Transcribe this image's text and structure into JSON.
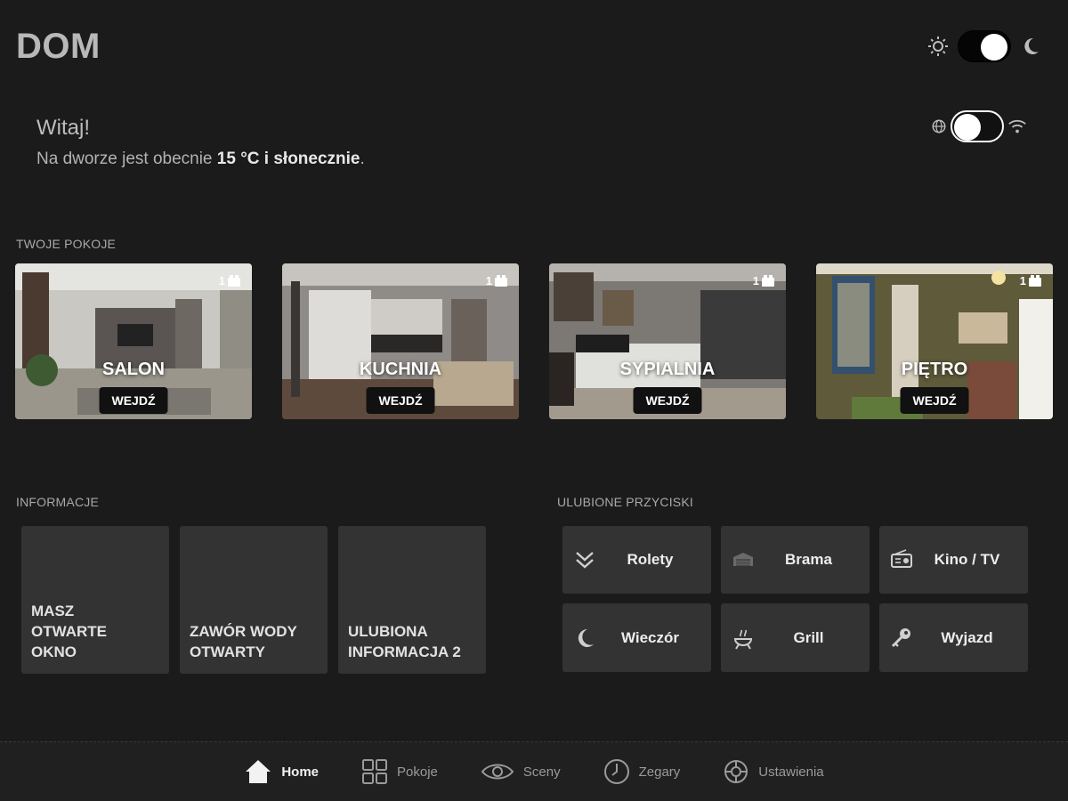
{
  "app": {
    "title": "DOM"
  },
  "greeting": {
    "hello": "Witaj!",
    "weather_prefix": "Na dworze jest obecnie",
    "weather_value": "15 °C i słonecznie",
    "weather_suffix": "."
  },
  "rooms_section": {
    "label": "TWOJE POKOJE",
    "rooms": [
      {
        "name": "SALON",
        "count": "1",
        "button": "WEJDŹ"
      },
      {
        "name": "KUCHNIA",
        "count": "1",
        "button": "WEJDŹ"
      },
      {
        "name": "SYPIALNIA",
        "count": "1",
        "button": "WEJDŹ"
      },
      {
        "name": "PIĘTRO",
        "count": "1",
        "button": "WEJDŹ"
      }
    ]
  },
  "info_section": {
    "label": "INFORMACJE",
    "tiles": [
      {
        "text": "MASZ\nOTWARTE\nOKNO"
      },
      {
        "text": "ZAWÓR WODY\nOTWARTY"
      },
      {
        "text": "ULUBIONA\nINFORMACJA 2"
      }
    ]
  },
  "favorites_section": {
    "label": "ULUBIONE PRZYCISKI",
    "buttons": [
      {
        "label": "Rolety",
        "icon": "double-chevron-down-icon"
      },
      {
        "label": "Brama",
        "icon": "gate-icon"
      },
      {
        "label": "Kino / TV",
        "icon": "radio-icon"
      },
      {
        "label": "Wieczór",
        "icon": "moon-icon"
      },
      {
        "label": "Grill",
        "icon": "grill-icon"
      },
      {
        "label": "Wyjazd",
        "icon": "key-icon"
      }
    ]
  },
  "nav": {
    "items": [
      {
        "label": "Home",
        "icon": "home-icon",
        "active": true
      },
      {
        "label": "Pokoje",
        "icon": "grid-icon",
        "active": false
      },
      {
        "label": "Sceny",
        "icon": "eye-icon",
        "active": false
      },
      {
        "label": "Zegary",
        "icon": "clock-icon",
        "active": false
      },
      {
        "label": "Ustawienia",
        "icon": "settings-wheel-icon",
        "active": false
      }
    ]
  },
  "colors": {
    "background": "#1b1b1b",
    "tile": "#333333",
    "nav": "#202020"
  }
}
